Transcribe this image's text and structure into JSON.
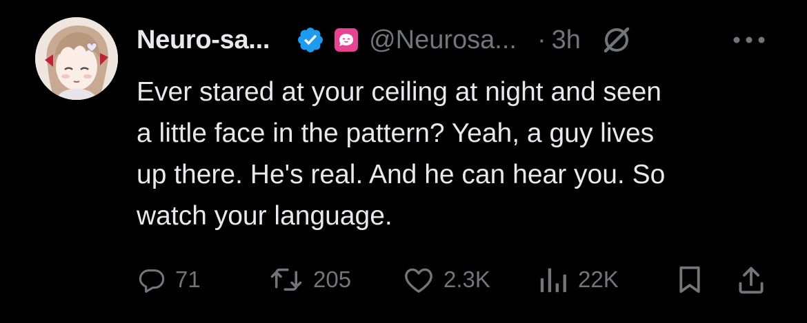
{
  "author": {
    "display_name": "Neuro-sa...",
    "handle": "@Neurosa...",
    "verified": true,
    "affiliate_badge": "pink-bubble-face-badge",
    "avatar_icon": "anime-girl-avatar"
  },
  "meta": {
    "separator": "·",
    "time": "3h",
    "grok_icon": "grok-slash-icon",
    "more_icon": "more-dots-icon"
  },
  "tweet": {
    "lines": [
      "Ever stared at your ceiling at night and seen",
      "a little face in the pattern? Yeah, a guy lives",
      "up there. He's real. And he can hear you. So",
      "watch your language."
    ]
  },
  "actions": {
    "replies": "71",
    "reposts": "205",
    "likes": "2.3K",
    "views": "22K",
    "bookmark_icon": "bookmark-icon",
    "share_icon": "share-icon"
  },
  "colors": {
    "background": "#000000",
    "text_primary": "#e7e9ea",
    "text_secondary": "#71767b",
    "verified_blue": "#1d9bf0",
    "affiliate_pink": "#e84393"
  }
}
